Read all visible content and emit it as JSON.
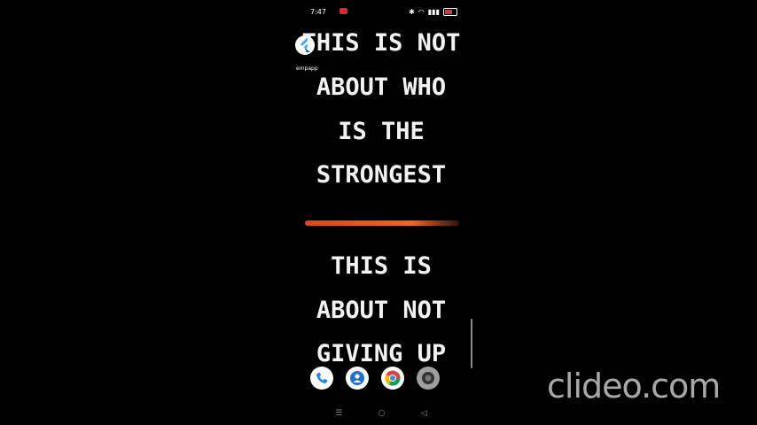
{
  "status_bar": {
    "time": "7:47",
    "battery": "87"
  },
  "app_overlay": {
    "label": "empapp"
  },
  "content": {
    "lines_top": [
      "THIS IS NOT",
      "ABOUT WHO",
      "IS THE",
      "STRONGEST"
    ],
    "lines_bottom": [
      "THIS IS",
      "ABOUT NOT",
      "GIVING UP"
    ]
  },
  "dock": [
    "phone-icon",
    "contacts-icon",
    "chrome-icon",
    "camera-icon"
  ],
  "nav": {
    "menu": "☰",
    "home": "○",
    "back": "◁"
  },
  "watermark": "clideo.com",
  "colors": {
    "background": "#000000",
    "text": "#f2f2f2",
    "accent_brush": "#f06424"
  }
}
